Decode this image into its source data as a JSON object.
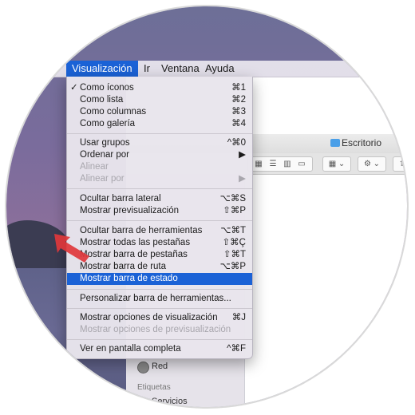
{
  "menubar": {
    "titles": [
      "Visualización",
      "Ir",
      "Ventana",
      "Ayuda"
    ]
  },
  "menu": {
    "check": "✓",
    "items": [
      {
        "label": "Como íconos",
        "shortcut": "⌘1"
      },
      {
        "label": "Como lista",
        "shortcut": "⌘2"
      },
      {
        "label": "Como columnas",
        "shortcut": "⌘3"
      },
      {
        "label": "Como galería",
        "shortcut": "⌘4"
      },
      {
        "label": "Usar grupos",
        "shortcut": "^⌘0"
      },
      {
        "label": "Ordenar por",
        "shortcut": "▶"
      },
      {
        "label": "Alinear",
        "shortcut": ""
      },
      {
        "label": "Alinear por",
        "shortcut": "▶"
      },
      {
        "label": "Ocultar barra lateral",
        "shortcut": "⌥⌘S"
      },
      {
        "label": "Mostrar previsualización",
        "shortcut": "⇧⌘P"
      },
      {
        "label": "Ocultar barra de herramientas",
        "shortcut": "⌥⌘T"
      },
      {
        "label": "Mostrar todas las pestañas",
        "shortcut": "⇧⌘Ç"
      },
      {
        "label": "Mostrar barra de pestañas",
        "shortcut": "⇧⌘T"
      },
      {
        "label": "Mostrar barra de ruta",
        "shortcut": "⌥⌘P"
      },
      {
        "label": "Mostrar barra de estado",
        "shortcut": ""
      },
      {
        "label": "Personalizar barra de herramientas...",
        "shortcut": ""
      },
      {
        "label": "Mostrar opciones de visualización",
        "shortcut": "⌘J"
      },
      {
        "label": "Mostrar opciones de previsualización",
        "shortcut": ""
      },
      {
        "label": "Ver en pantalla completa",
        "shortcut": "^⌘F"
      }
    ]
  },
  "finder": {
    "window_title": "Escritorio",
    "toolbar": {
      "view_icons": [
        "▦",
        "☰",
        "▥",
        "▭"
      ],
      "group_icon": "▦ ⌄",
      "action_icon": "⚙ ⌄",
      "share_icon": "⇪"
    },
    "sidebar": {
      "network_item": "Red",
      "tags_header": "Etiquetas",
      "tag_item": "Servicios"
    }
  },
  "colors": {
    "highlight": "#1b62d6",
    "arrow": "#e0373b"
  }
}
